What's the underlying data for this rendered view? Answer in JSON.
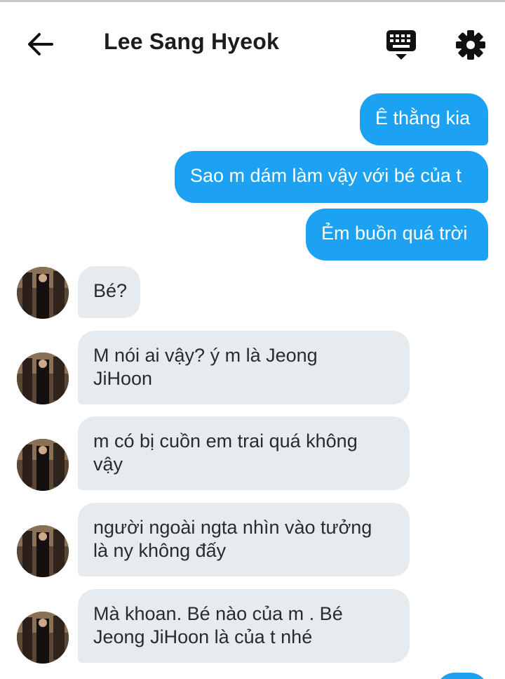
{
  "header": {
    "title": "Lee Sang Hyeok",
    "back_icon": "arrow-left-icon",
    "keyboard_icon": "keyboard-icon",
    "settings_icon": "gear-icon"
  },
  "colors": {
    "sent_bubble": "#1da1f2",
    "received_bubble": "#e6ebef",
    "text_dark": "#1c1c1c"
  },
  "messages": [
    {
      "from": "me",
      "text": "Ê thằng kia"
    },
    {
      "from": "me",
      "text": "Sao m dám làm vậy với bé của t"
    },
    {
      "from": "me",
      "text": "Ẻm buồn quá trời"
    },
    {
      "from": "them",
      "text": "Bé?"
    },
    {
      "from": "them",
      "lines": [
        "M nói ai vậy? ý m là Jeong",
        "JiHoon"
      ]
    },
    {
      "from": "them",
      "lines": [
        "m có bị cuồn em trai quá không",
        "vậy"
      ]
    },
    {
      "from": "them",
      "lines": [
        "người ngoài ngta nhìn vào tưởng",
        "là ny không đấy"
      ]
    },
    {
      "from": "them",
      "lines": [
        "Mà khoan. Bé nào của m . Bé",
        "Jeong JiHoon là của t nhé"
      ]
    }
  ]
}
